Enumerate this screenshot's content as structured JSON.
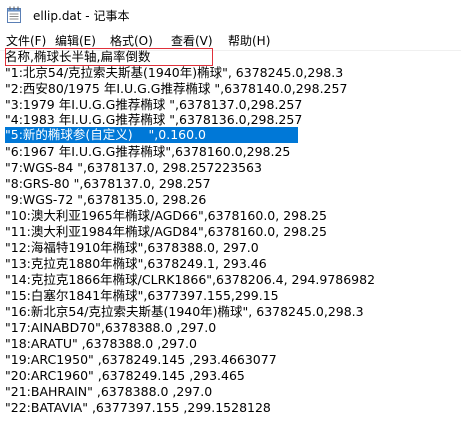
{
  "window": {
    "title": "ellip.dat - 记事本"
  },
  "icons": {
    "app": "notepad-icon"
  },
  "colors": {
    "selection": "#0078d7",
    "highlight_box": "#e0303a"
  },
  "menu": {
    "items": [
      {
        "label": "文件(F)"
      },
      {
        "label": "编辑(E)"
      },
      {
        "label": "格式(O)"
      },
      {
        "label": "查看(V)"
      },
      {
        "label": "帮助(H)"
      }
    ]
  },
  "editor": {
    "lines": [
      {
        "text": "名称,椭球长半轴,扁率倒数"
      },
      {
        "text": "\"1:北京54/克拉索夫斯基(1940年)椭球\", 6378245.0,298.3"
      },
      {
        "text": "\"2:西安80/1975 年I.U.G.G推荐椭球 \",6378140.0,298.257"
      },
      {
        "text": "\"3:1979 年I.U.G.G推荐椭球 \",6378137.0,298.257"
      },
      {
        "text": "\"4:1983 年I.U.G.G推荐椭球 \",6378136.0,298.257"
      },
      {
        "text": "\"5:新的椭球参(自定义)    \",0.160.0"
      },
      {
        "text": "\"6:1967 年I.U.G.G推荐椭球\",6378160.0,298.25"
      },
      {
        "text": "\"7:WGS-84 \",6378137.0, 298.257223563"
      },
      {
        "text": "\"8:GRS-80 \",6378137.0, 298.257"
      },
      {
        "text": "\"9:WGS-72 \",6378135.0, 298.26"
      },
      {
        "text": "\"10:澳大利亚1965年椭球/AGD66\",6378160.0, 298.25"
      },
      {
        "text": "\"11:澳大利亚1984年椭球/AGD84\",6378160.0, 298.25"
      },
      {
        "text": "\"12:海福特1910年椭球\",6378388.0, 297.0"
      },
      {
        "text": "\"13:克拉克1880年椭球\",6378249.1, 293.46"
      },
      {
        "text": "\"14:克拉克1866年椭球/CLRK1866\",6378206.4, 294.9786982"
      },
      {
        "text": "\"15:白塞尔1841年椭球\",6377397.155,299.15"
      },
      {
        "text": "\"16:新北京54/克拉索夫斯基(1940年)椭球\", 6378245.0,298.3"
      },
      {
        "text": "\"17:AINABD70\",6378388.0 ,297.0"
      },
      {
        "text": "\"18:ARATU\" ,6378388.0 ,297.0"
      },
      {
        "text": "\"19:ARC1950\" ,6378249.145 ,293.4663077"
      },
      {
        "text": "\"20:ARC1960\" ,6378249.145 ,293.465"
      },
      {
        "text": "\"21:BAHRAIN\" ,6378388.0 ,297.0"
      },
      {
        "text": "\"22:BATAVIA\" ,6377397.155 ,299.1528128"
      }
    ]
  }
}
